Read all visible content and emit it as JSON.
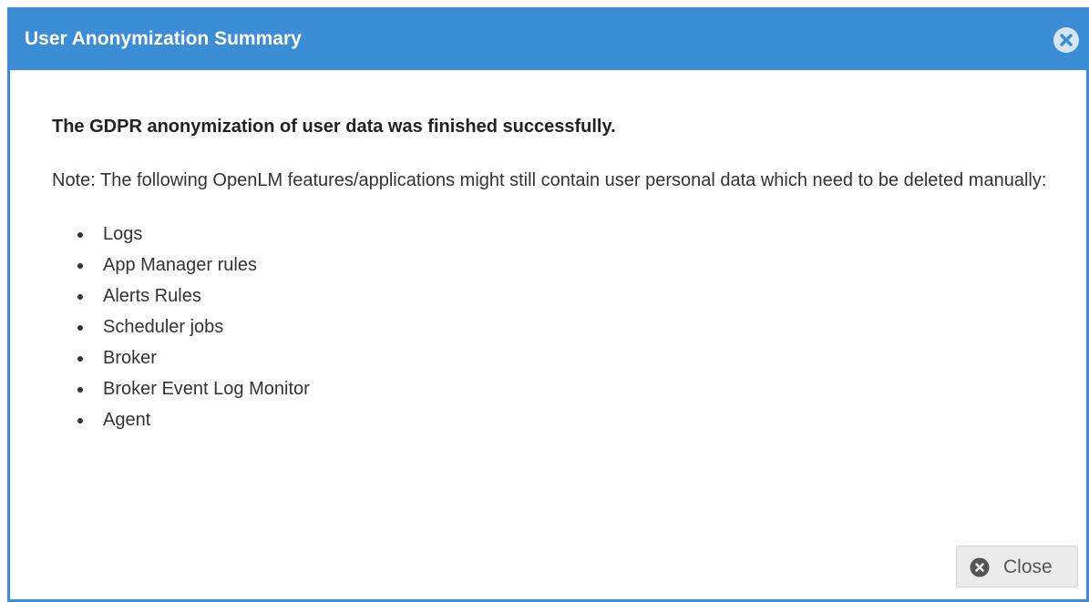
{
  "dialog": {
    "title": "User Anonymization Summary",
    "heading": "The GDPR anonymization of user data was finished successfully.",
    "note": "Note: The following OpenLM features/applications might still contain user personal data which need to be deleted manually:",
    "items": [
      "Logs",
      "App Manager rules",
      "Alerts Rules",
      "Scheduler jobs",
      "Broker",
      "Broker Event Log Monitor",
      "Agent"
    ],
    "close_label": "Close"
  },
  "colors": {
    "titlebar": "#3b8ed6",
    "button_bg": "#ebebeb"
  },
  "icons": {
    "title_close": "close-circle-icon",
    "button_close": "close-circle-icon"
  }
}
